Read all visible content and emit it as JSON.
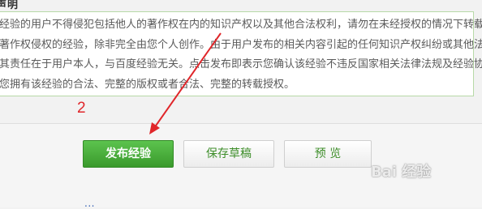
{
  "notice": {
    "heading": "声明",
    "lines": [
      "经验的用户不得侵犯包括他人的著作权在内的知识产权以及其他合法权利，请勿在未经授权的情况下转载任何",
      "著作权侵权的经验，除非完全由您个人创作。由于用户发布的相关内容引起的任何知识产权纠纷或其他法律纠",
      "其责任在于用户本人，与百度经验无关。点击发布即表示您确认该经验不违反国家相关法律法规及经验协议，",
      "您拥有该经验的合法、完整的版权或者合法、完整的转载授权。"
    ]
  },
  "annotation": {
    "step": "2",
    "color": "#e0262a"
  },
  "actions": {
    "publish_label": "发布经验",
    "save_draft_label": "保存草稿",
    "preview_label": "预 览"
  },
  "watermark": {
    "text": "Bai 经验"
  },
  "footer": {
    "link_text": "..."
  },
  "colors": {
    "publish": "#4cb33c",
    "accent_text": "#3e8e2a"
  }
}
